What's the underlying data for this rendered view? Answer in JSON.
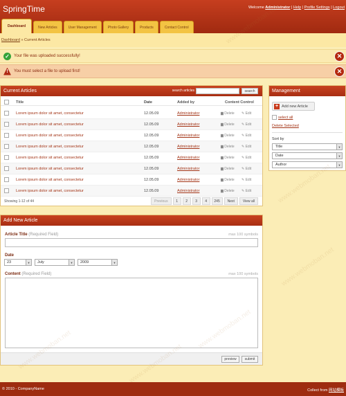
{
  "header": {
    "logo": "SpringTime",
    "welcome": "Welcome",
    "user": "Administrator",
    "links": [
      "Help",
      "Profile Settings",
      "Logout"
    ]
  },
  "tabs": [
    "Dashboard",
    "New Articles",
    "User Management",
    "Photo Gallery",
    "Products",
    "Contact Control"
  ],
  "breadcrumb": {
    "home": "Dashboard",
    "sep": "»",
    "current": "Current Articles"
  },
  "messages": {
    "success": "Your file was uploaded successfully!",
    "error": "You must select a file to upload first!",
    "close_glyph": "✕"
  },
  "articles": {
    "title": "Current Articles",
    "search_label": "search articles",
    "search_button": "search",
    "columns": {
      "title": "Title",
      "date": "Date",
      "added_by": "Added by",
      "control": "Content Control"
    },
    "delete_label": "Delete",
    "edit_label": "Edit",
    "rows": [
      {
        "title": "Lorem ipsum dolor sit amet, consectetur",
        "date": "12.05.09",
        "added_by": "Administrator"
      },
      {
        "title": "Lorem ipsum dolor sit amet, consectetur",
        "date": "12.05.09",
        "added_by": "Administrator"
      },
      {
        "title": "Lorem ipsum dolor sit amet, consectetur",
        "date": "12.05.09",
        "added_by": "Administrator"
      },
      {
        "title": "Lorem ipsum dolor sit amet, consectetur",
        "date": "12.05.09",
        "added_by": "Administrator"
      },
      {
        "title": "Lorem ipsum dolor sit amet, consectetur",
        "date": "12.05.09",
        "added_by": "Administrator"
      },
      {
        "title": "Lorem ipsum dolor sit amet, consectetur",
        "date": "12.05.09",
        "added_by": "Administrator"
      },
      {
        "title": "Lorem ipsum dolor sit amet, consectetur",
        "date": "12.05.09",
        "added_by": "Administrator"
      },
      {
        "title": "Lorem ipsum dolor sit amet, consectetur",
        "date": "12.05.09",
        "added_by": "Administrator"
      }
    ],
    "showing": "Showing 1-12 of 44",
    "pager": {
      "previous": "Previous",
      "pages": [
        "1",
        "2",
        "3",
        "4"
      ],
      "more": "245",
      "next": "Next",
      "view_all": "View all"
    }
  },
  "management": {
    "title": "Management",
    "add_button": "Add new Article",
    "select_all": "select all",
    "delete_selected": "Delete Selected",
    "sort_by": "Sort by",
    "sort_options": [
      "Title",
      "Date",
      "Author"
    ]
  },
  "add_form": {
    "title": "Add New Article",
    "article_title_label": "Article Title",
    "required": "(Required Field)",
    "max_hint": "max 100 symbols",
    "date_label": "Date",
    "day": "23",
    "month": "July",
    "year": "2009",
    "content_label": "Content",
    "preview_button": "preview",
    "submit_button": "submit"
  },
  "footer": {
    "copyright": "© 2010 - CompanyName",
    "credit_prefix": "Collect from",
    "credit_link": "网站模板"
  },
  "watermark": "www.webmoban.net",
  "colors": {
    "header": "#b5371a",
    "tab": "#f3c343",
    "background": "#fbedb6",
    "accent_link": "#a33416"
  }
}
